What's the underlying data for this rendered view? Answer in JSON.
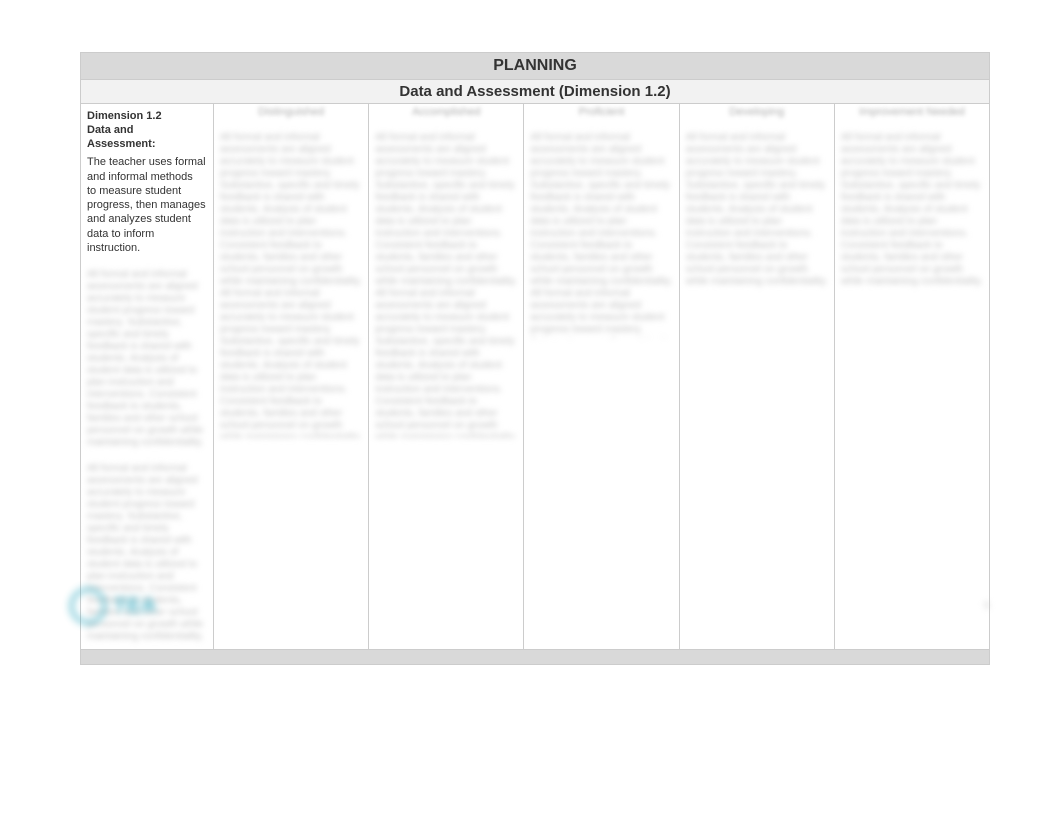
{
  "header": {
    "line1": "PLANNING",
    "line2": "Data and Assessment (Dimension 1.2)"
  },
  "dimension": {
    "title_line1": "Dimension 1.2",
    "title_line2": "Data and",
    "title_line3": "Assessment:",
    "body_line1": "The teacher uses formal and informal methods",
    "body_line2": "to measure student progress, then manages and analyzes student data to inform instruction."
  },
  "columns": {
    "headers": [
      "Distinguished",
      "Accomplished",
      "Proficient",
      "Developing",
      "Improvement Needed"
    ]
  },
  "blur_filler": "All formal and informal assessments are aligned accurately to measure student progress toward mastery. Substantive, specific and timely feedback is shared with students. Analysis of student data is utilized to plan instruction and interventions. Consistent feedback to students, families and other school personnel on growth while maintaining confidentiality.",
  "logo_text": "TEA",
  "page_number": "5"
}
